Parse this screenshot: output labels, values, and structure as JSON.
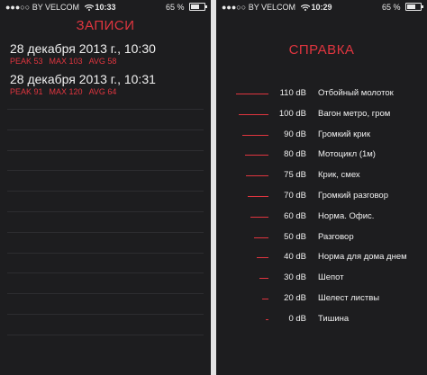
{
  "status_left": {
    "carrier": "BY VELCOM",
    "time": "10:33",
    "battery": "65 %"
  },
  "status_right": {
    "carrier": "BY VELCOM",
    "time": "10:29",
    "battery": "65 %"
  },
  "battery_level": 0.65,
  "records": {
    "title": "ЗАПИСИ",
    "items": [
      {
        "date": "28 декабря 2013 г., 10:30",
        "peak": "PEAK 53",
        "max": "MAX 103",
        "avg": "AVG 58"
      },
      {
        "date": "28 декабря 2013 г., 10:31",
        "peak": "PEAK 91",
        "max": "MAX 120",
        "avg": "AVG 64"
      }
    ]
  },
  "reference": {
    "title": "СПРАВКА",
    "levels": [
      {
        "db": "110 dB",
        "desc": "Отбойный молоток"
      },
      {
        "db": "100 dB",
        "desc": "Вагон метро, гром"
      },
      {
        "db": "90 dB",
        "desc": "Громкий крик"
      },
      {
        "db": "80 dB",
        "desc": "Мотоцикл (1м)"
      },
      {
        "db": "75 dB",
        "desc": "Крик, смех"
      },
      {
        "db": "70 dB",
        "desc": "Громкий разговор"
      },
      {
        "db": "60 dB",
        "desc": "Норма. Офис."
      },
      {
        "db": "50 dB",
        "desc": "Разговор"
      },
      {
        "db": "40 dB",
        "desc": "Норма для дома днем"
      },
      {
        "db": "30 dB",
        "desc": "Шепот"
      },
      {
        "db": "20 dB",
        "desc": "Шелест листвы"
      },
      {
        "db": "0 dB",
        "desc": "Тишина"
      }
    ]
  },
  "colors": {
    "accent": "#e0353f",
    "background": "#1d1d1f",
    "text": "#f0f0f0"
  }
}
